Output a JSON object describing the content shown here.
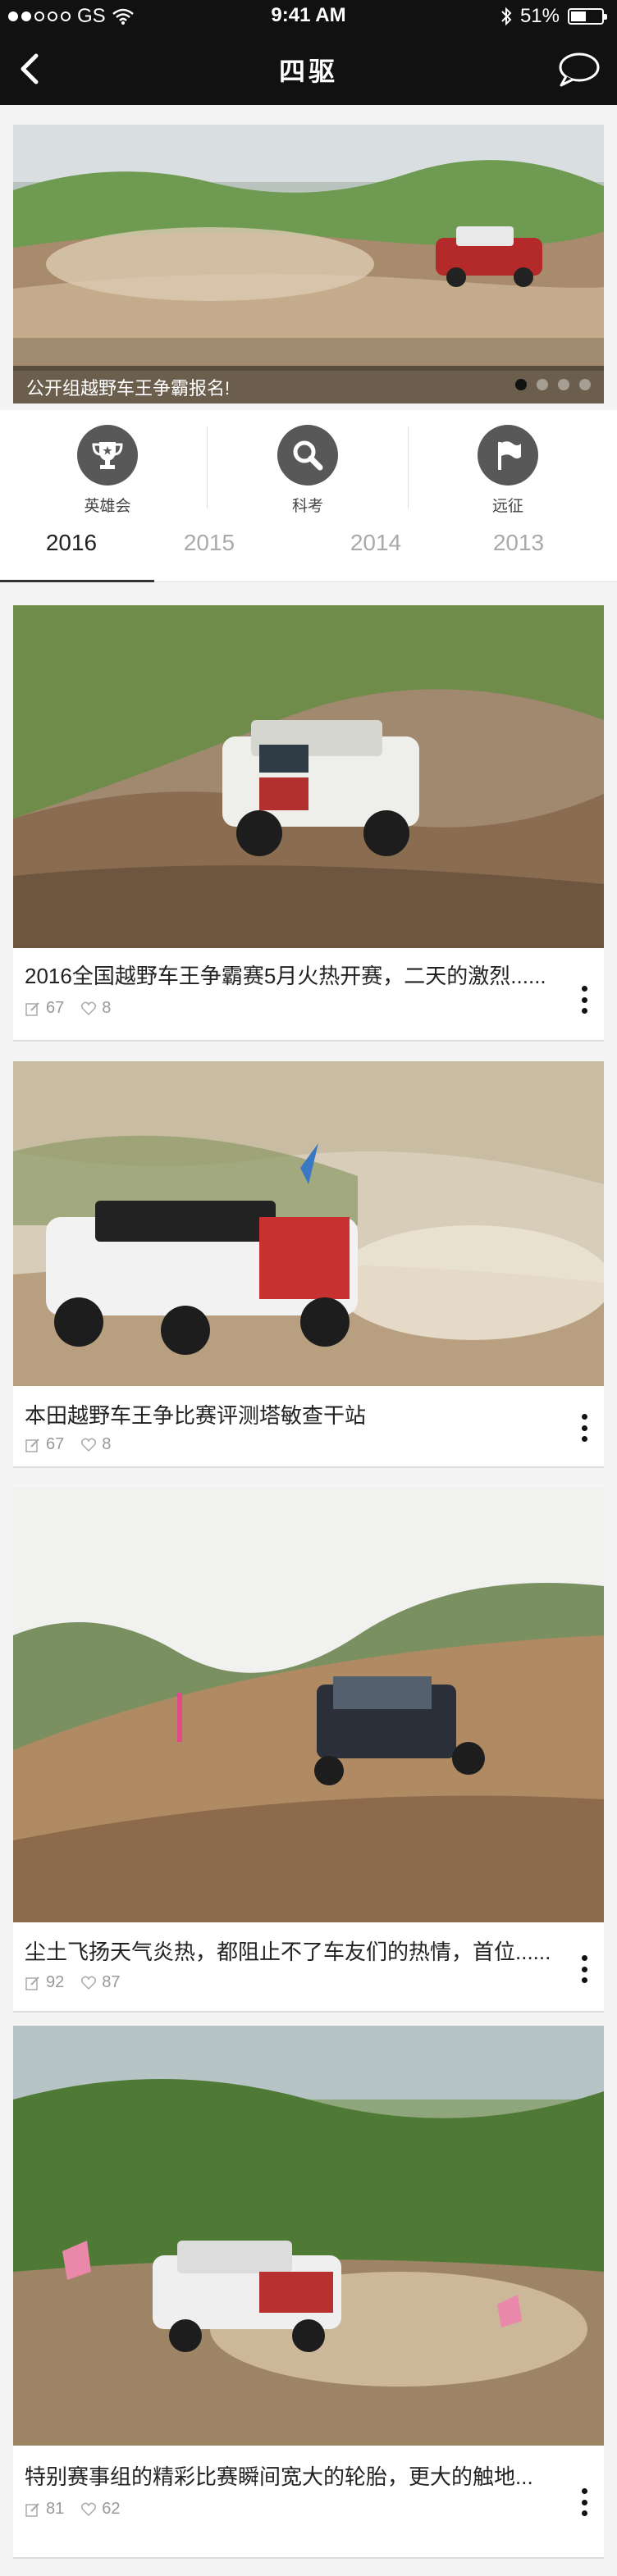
{
  "status": {
    "carrier": "GS",
    "time": "9:41 AM",
    "battery_pct": 51,
    "battery_label": "51%"
  },
  "nav": {
    "title": "四驱",
    "back_icon": "chevron-left-icon",
    "chat_icon": "chat-bubble-icon"
  },
  "banner": {
    "caption": "公开组越野车王争霸报名!",
    "slide_count": 4,
    "active_slide": 1
  },
  "categories": [
    {
      "label": "英雄会",
      "icon": "trophy-icon"
    },
    {
      "label": "科考",
      "icon": "search-icon"
    },
    {
      "label": "远征",
      "icon": "flag-icon"
    }
  ],
  "years": [
    "2016",
    "2015",
    "2014",
    "2013"
  ],
  "active_year": "2016",
  "articles": [
    {
      "title": "2016全国越野车王争霸赛5月火热开赛，二天的激烈......",
      "edits": "67",
      "likes": "8"
    },
    {
      "title": "本田越野车王争比赛评测塔敏查干站",
      "edits": "67",
      "likes": "8"
    },
    {
      "title": "尘土飞扬天气炎热，都阻止不了车友们的热情，首位......",
      "edits": "92",
      "likes": "87"
    },
    {
      "title": "特别赛事组的精彩比赛瞬间宽大的轮胎，更大的触地...",
      "edits": "81",
      "likes": "62"
    }
  ]
}
